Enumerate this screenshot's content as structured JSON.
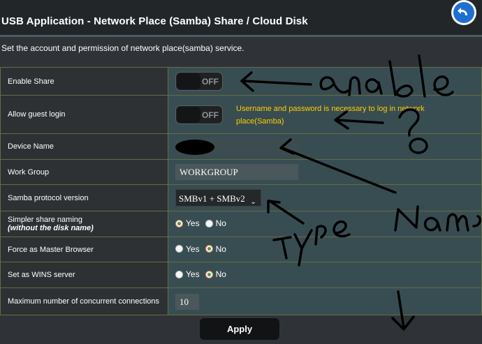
{
  "header": {
    "title": "USB Application - Network Place (Samba) Share / Cloud Disk",
    "back_icon": "back-arrow-icon"
  },
  "description": "Set the account and permission of network place(samba) service.",
  "settings": {
    "enable_share": {
      "label": "Enable Share",
      "state": "OFF"
    },
    "allow_guest": {
      "label": "Allow guest login",
      "state": "OFF",
      "hint": "Username and password is necessary to log in network place(Samba)"
    },
    "device_name": {
      "label": "Device Name",
      "value": ""
    },
    "work_group": {
      "label": "Work Group",
      "value": "WORKGROUP"
    },
    "samba_version": {
      "label": "Samba protocol version",
      "selected": "SMBv1 + SMBv2"
    },
    "simpler_naming": {
      "label": "Simpler share naming",
      "sublabel": "(without the disk name)",
      "yes": "Yes",
      "no": "No",
      "selected": "Yes"
    },
    "master_browser": {
      "label": "Force as Master Browser",
      "yes": "Yes",
      "no": "No",
      "selected": "No"
    },
    "wins_server": {
      "label": "Set as WINS server",
      "yes": "Yes",
      "no": "No",
      "selected": "No"
    },
    "max_connections": {
      "label": "Maximum number of concurrent connections",
      "value": "10"
    }
  },
  "apply_label": "Apply",
  "colors": {
    "hint": "#ffcc00",
    "value_cell": "#384d52",
    "label_cell": "#2d3134",
    "border": "#676c43"
  }
}
